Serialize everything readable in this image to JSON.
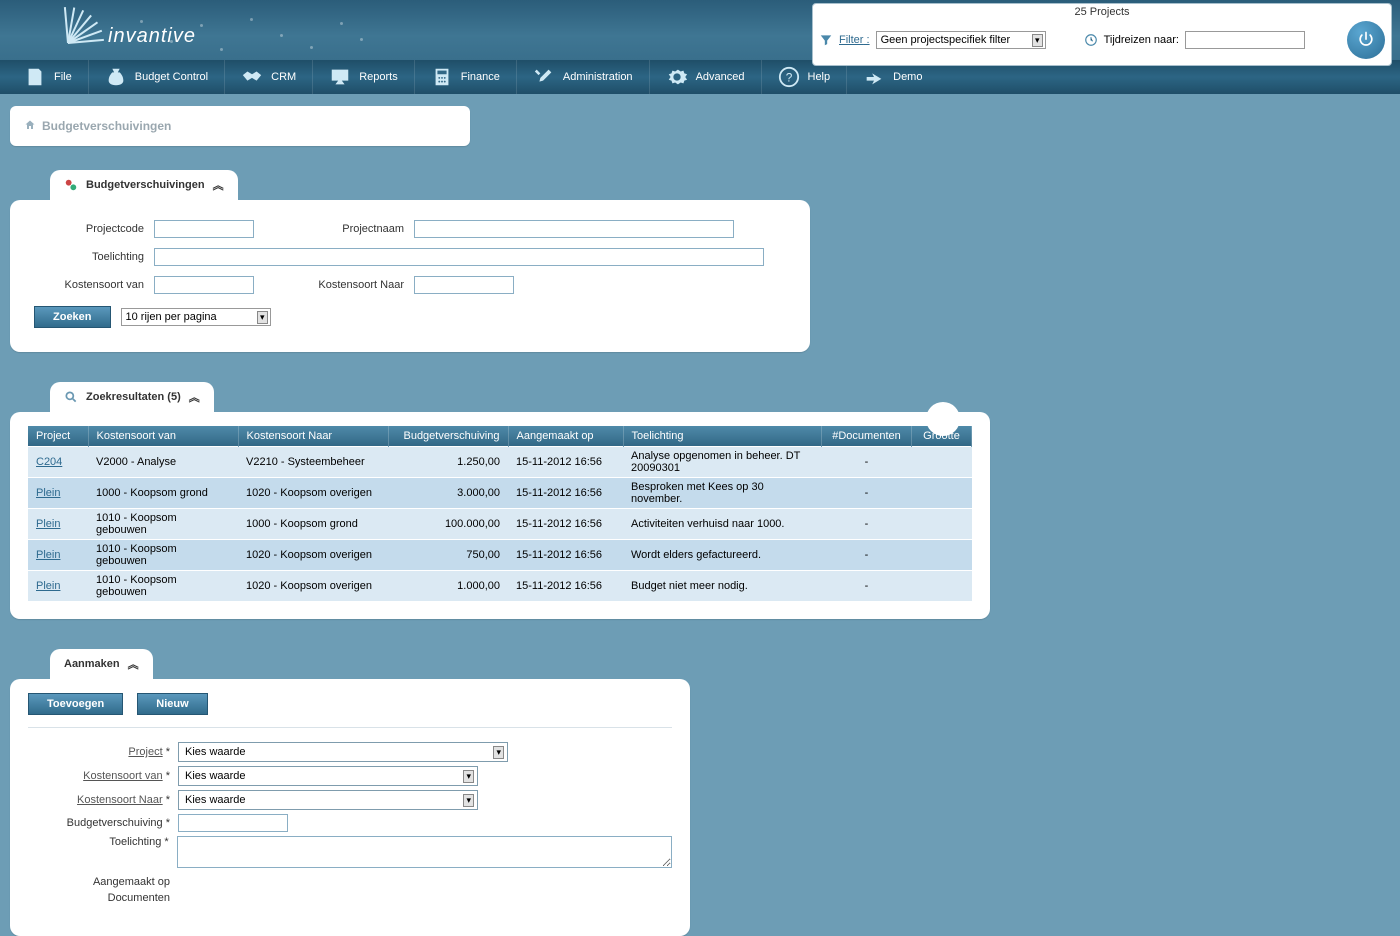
{
  "header": {
    "brand": "invantive",
    "projects_count": "25 Projects",
    "filter_label": "Filter",
    "filter_value": "Geen projectspecifiek filter",
    "time_label": "Tijdreizen naar:",
    "time_value": ""
  },
  "menu": [
    {
      "key": "file",
      "label": "File"
    },
    {
      "key": "budget",
      "label": "Budget Control"
    },
    {
      "key": "crm",
      "label": "CRM"
    },
    {
      "key": "reports",
      "label": "Reports"
    },
    {
      "key": "finance",
      "label": "Finance"
    },
    {
      "key": "admin",
      "label": "Administration"
    },
    {
      "key": "adv",
      "label": "Advanced"
    },
    {
      "key": "help",
      "label": "Help"
    },
    {
      "key": "demo",
      "label": "Demo"
    }
  ],
  "breadcrumb": {
    "title": "Budgetverschuivingen"
  },
  "search_panel": {
    "title": "Budgetverschuivingen",
    "labels": {
      "projectcode": "Projectcode",
      "projectnaam": "Projectnaam",
      "toelichting": "Toelichting",
      "kostensoort_van": "Kostensoort van",
      "kostensoort_naar": "Kostensoort Naar"
    },
    "values": {
      "projectcode": "",
      "projectnaam": "",
      "toelichting": "",
      "kostensoort_van": "",
      "kostensoort_naar": ""
    },
    "search_btn": "Zoeken",
    "pagesize": "10 rijen per pagina"
  },
  "results_panel": {
    "title": "Zoekresultaten (5)",
    "columns": {
      "project": "Project",
      "kvan": "Kostensoort van",
      "knaar": "Kostensoort Naar",
      "budget": "Budgetverschuiving",
      "aangemaakt": "Aangemaakt op",
      "toelichting": "Toelichting",
      "docs": "#Documenten",
      "grootte": "Grootte"
    },
    "rows": [
      {
        "project": "C204",
        "kvan": "V2000 - Analyse",
        "knaar": "V2210 - Systeembeheer",
        "budget": "1.250,00",
        "aangemaakt": "15-11-2012 16:56",
        "toelichting": "Analyse opgenomen in beheer. DT 20090301",
        "docs": "-",
        "grootte": ""
      },
      {
        "project": "Plein",
        "kvan": "1000 - Koopsom grond",
        "knaar": "1020 - Koopsom overigen",
        "budget": "3.000,00",
        "aangemaakt": "15-11-2012 16:56",
        "toelichting": "Besproken met Kees op 30 november.",
        "docs": "-",
        "grootte": ""
      },
      {
        "project": "Plein",
        "kvan": "1010 - Koopsom gebouwen",
        "knaar": "1000 - Koopsom grond",
        "budget": "100.000,00",
        "aangemaakt": "15-11-2012 16:56",
        "toelichting": "Activiteiten verhuisd naar 1000.",
        "docs": "-",
        "grootte": ""
      },
      {
        "project": "Plein",
        "kvan": "1010 - Koopsom gebouwen",
        "knaar": "1020 - Koopsom overigen",
        "budget": "750,00",
        "aangemaakt": "15-11-2012 16:56",
        "toelichting": "Wordt elders gefactureerd.",
        "docs": "-",
        "grootte": ""
      },
      {
        "project": "Plein",
        "kvan": "1010 - Koopsom gebouwen",
        "knaar": "1020 - Koopsom overigen",
        "budget": "1.000,00",
        "aangemaakt": "15-11-2012 16:56",
        "toelichting": "Budget niet meer nodig.",
        "docs": "-",
        "grootte": ""
      }
    ]
  },
  "create_panel": {
    "title": "Aanmaken",
    "toevoegen": "Toevoegen",
    "nieuw": "Nieuw",
    "labels": {
      "project": "Project",
      "kvan": "Kostensoort van",
      "knaar": "Kostensoort Naar",
      "budget": "Budgetverschuiving",
      "toelichting": "Toelichting",
      "aangemaakt": "Aangemaakt op",
      "documenten": "Documenten"
    },
    "values": {
      "project": "Kies waarde",
      "kvan": "Kies waarde",
      "knaar": "Kies waarde",
      "budget": "",
      "toelichting": ""
    },
    "req": "*"
  }
}
